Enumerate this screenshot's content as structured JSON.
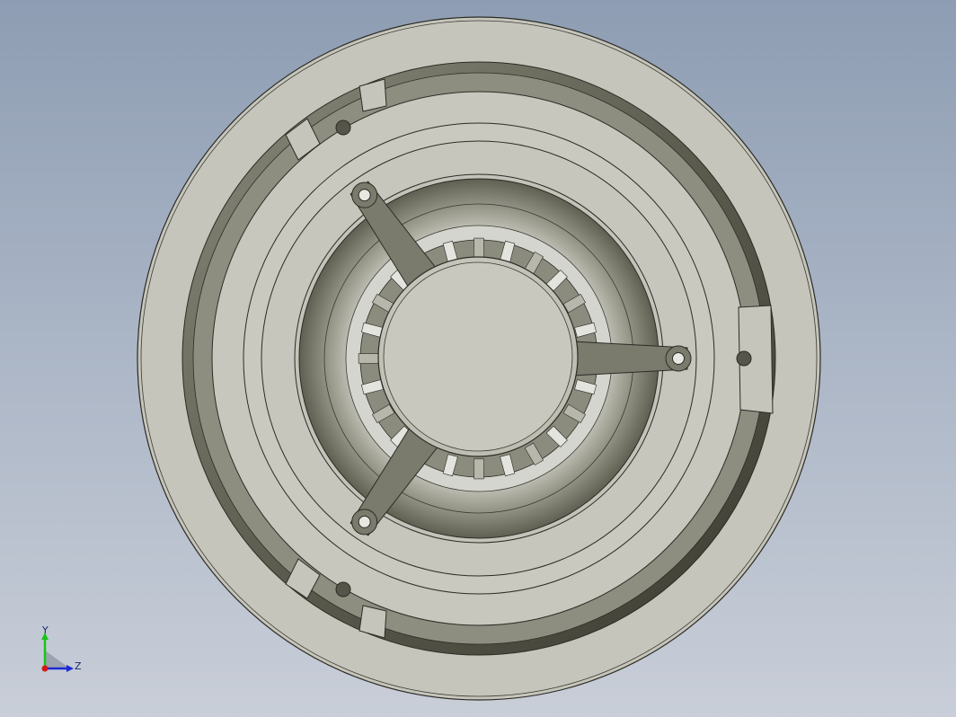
{
  "viewport": {
    "background_top": "#8e9db3",
    "background_bottom": "#c9ced8"
  },
  "model": {
    "part_color": "#c6c6bc",
    "recess_color": "#6d6d5f",
    "edge_color": "#2c2c26",
    "spoke_count": 3,
    "vane_count": 24
  },
  "triad": {
    "y_label": "Y",
    "z_label": "Z",
    "y_color": "#19c419",
    "z_color": "#1d2bd6",
    "origin_color": "#d21818"
  }
}
